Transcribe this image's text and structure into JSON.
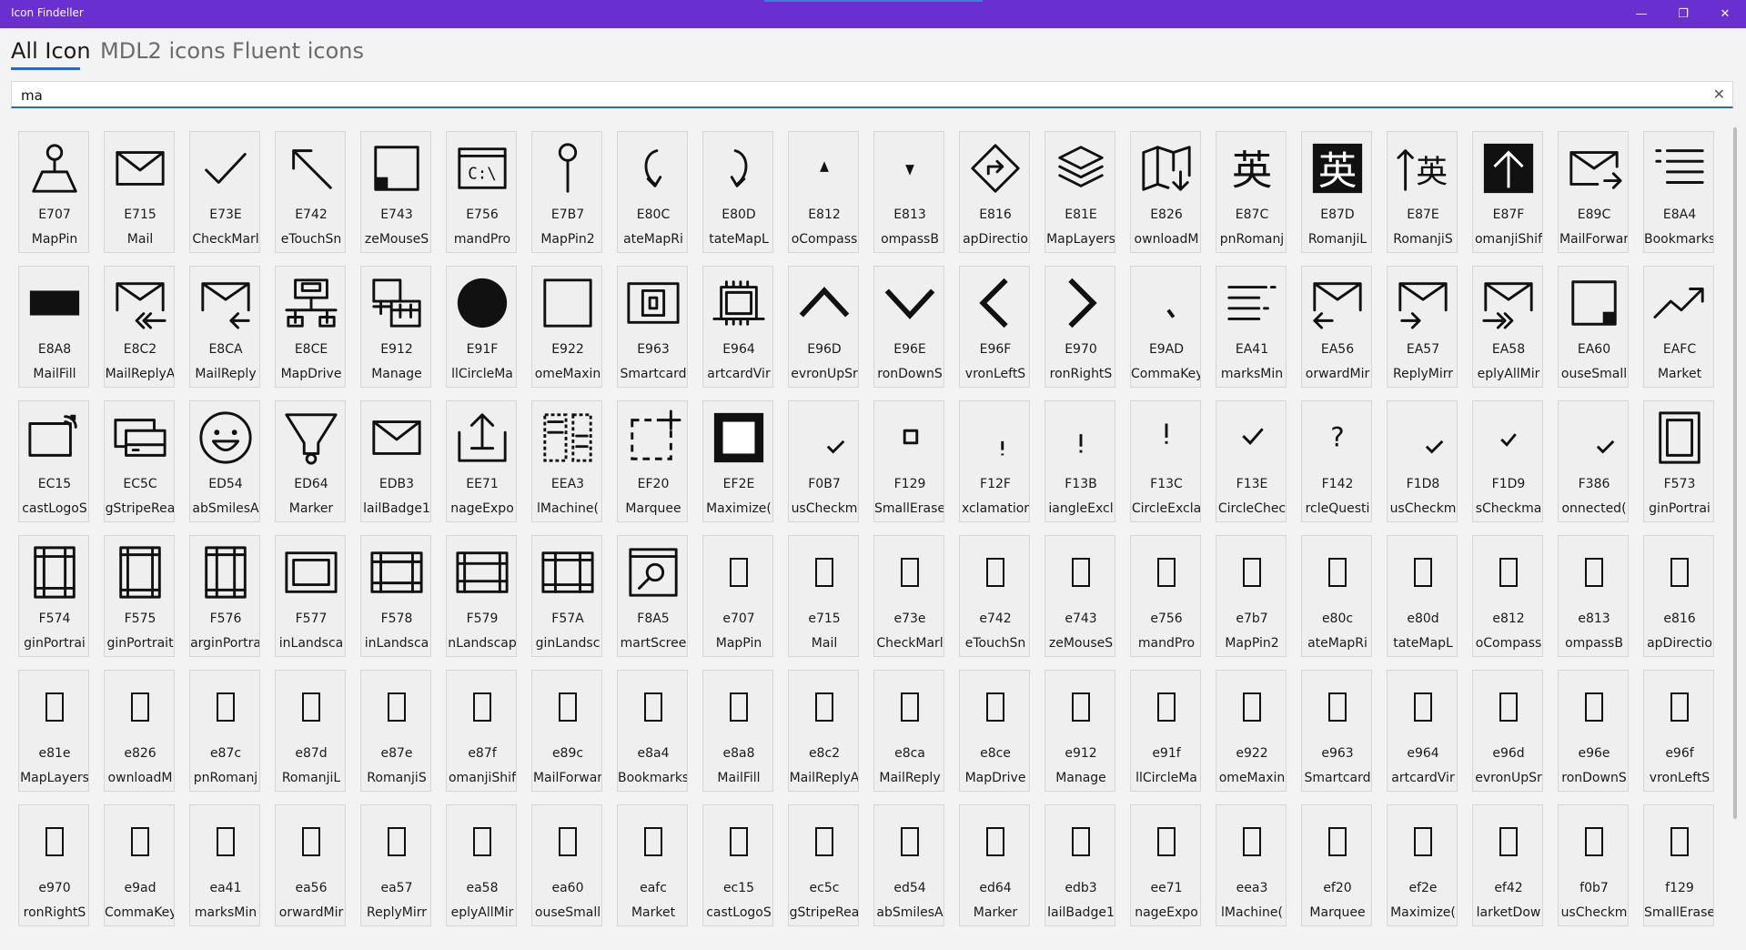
{
  "window": {
    "title": "Icon Findeller",
    "min_icon": "minimize-icon",
    "max_icon": "restore-icon",
    "close_icon": "close-icon"
  },
  "tabs": [
    {
      "label": "All Icon",
      "active": true
    },
    {
      "label": "MDL2 icons",
      "active": false
    },
    {
      "label": "Fluent icons",
      "active": false
    }
  ],
  "search": {
    "value": "ma",
    "clear_icon": "clear-icon"
  },
  "colors": {
    "titlebar": "#6a2fd1",
    "accent": "#2b67c6"
  },
  "icons": [
    {
      "code": "E707",
      "name": "MapPin",
      "glyph": "map-pin"
    },
    {
      "code": "E715",
      "name": "Mail",
      "glyph": "mail"
    },
    {
      "code": "E73E",
      "name": "CheckMarl",
      "glyph": "checkmark"
    },
    {
      "code": "E742",
      "name": "eTouchSn",
      "glyph": "arrow-upleft"
    },
    {
      "code": "E743",
      "name": "zeMouseS",
      "glyph": "square-corner"
    },
    {
      "code": "E756",
      "name": "mandPro",
      "glyph": "command-prompt"
    },
    {
      "code": "E7B7",
      "name": "MapPin2",
      "glyph": "pin2"
    },
    {
      "code": "E80C",
      "name": "ateMapRi",
      "glyph": "rotate-right"
    },
    {
      "code": "E80D",
      "name": "tateMapL",
      "glyph": "rotate-left"
    },
    {
      "code": "E812",
      "name": "oCompass",
      "glyph": "tri-up"
    },
    {
      "code": "E813",
      "name": "ompassB",
      "glyph": "tri-down"
    },
    {
      "code": "E816",
      "name": "apDirectio",
      "glyph": "directions"
    },
    {
      "code": "E81E",
      "name": "MapLayers",
      "glyph": "layers"
    },
    {
      "code": "E826",
      "name": "ownloadM",
      "glyph": "map-download"
    },
    {
      "code": "E87C",
      "name": "pnRomanj",
      "glyph": "kanji"
    },
    {
      "code": "E87D",
      "name": "RomanjiL",
      "glyph": "kanji-inv"
    },
    {
      "code": "E87E",
      "name": "RomanjiS",
      "glyph": "kanji-arrow"
    },
    {
      "code": "E87F",
      "name": "omanjiShif",
      "glyph": "shift-box"
    },
    {
      "code": "E89C",
      "name": "MailForwar",
      "glyph": "mail-forward"
    },
    {
      "code": "E8A4",
      "name": "Bookmarks",
      "glyph": "bookmarks"
    },
    {
      "code": "E8A8",
      "name": "MailFill",
      "glyph": "mail-fill"
    },
    {
      "code": "E8C2",
      "name": "MailReplyA",
      "glyph": "mail-replyall"
    },
    {
      "code": "E8CA",
      "name": "MailReply",
      "glyph": "mail-reply"
    },
    {
      "code": "E8CE",
      "name": "MapDrive",
      "glyph": "map-drive"
    },
    {
      "code": "E912",
      "name": "Manage",
      "glyph": "manage"
    },
    {
      "code": "E91F",
      "name": "llCircleMa",
      "glyph": "circle-fill"
    },
    {
      "code": "E922",
      "name": "omeMaxin",
      "glyph": "square"
    },
    {
      "code": "E963",
      "name": "Smartcard",
      "glyph": "smartcard"
    },
    {
      "code": "E964",
      "name": "artcardVir",
      "glyph": "chip"
    },
    {
      "code": "E96D",
      "name": "evronUpSr",
      "glyph": "chevron-up"
    },
    {
      "code": "E96E",
      "name": "ronDownS",
      "glyph": "chevron-down"
    },
    {
      "code": "E96F",
      "name": "vronLeftS",
      "glyph": "chevron-left"
    },
    {
      "code": "E970",
      "name": "ronRightS",
      "glyph": "chevron-right"
    },
    {
      "code": "E9AD",
      "name": "CommaKey",
      "glyph": "comma"
    },
    {
      "code": "EA41",
      "name": "marksMin",
      "glyph": "bookmarks-small"
    },
    {
      "code": "EA56",
      "name": "orwardMir",
      "glyph": "mail-forward-mirror"
    },
    {
      "code": "EA57",
      "name": "ReplyMirr",
      "glyph": "mail-reply-mirror"
    },
    {
      "code": "EA58",
      "name": "eplyAllMir",
      "glyph": "mail-replyall-mirror"
    },
    {
      "code": "EA60",
      "name": "ouseSmall",
      "glyph": "square-corner-br"
    },
    {
      "code": "EAFC",
      "name": "Market",
      "glyph": "trend"
    },
    {
      "code": "EC15",
      "name": "castLogoS",
      "glyph": "cast"
    },
    {
      "code": "EC5C",
      "name": "gStripeRea",
      "glyph": "card-stripe"
    },
    {
      "code": "ED54",
      "name": "abSmilesA",
      "glyph": "smile"
    },
    {
      "code": "ED64",
      "name": "Marker",
      "glyph": "marker"
    },
    {
      "code": "EDB3",
      "name": "lailBadge1",
      "glyph": "mail-badge"
    },
    {
      "code": "EE71",
      "name": "nageExpo",
      "glyph": "export"
    },
    {
      "code": "EEA3",
      "name": "lMachine(",
      "glyph": "machine"
    },
    {
      "code": "EF20",
      "name": "Marquee",
      "glyph": "marquee"
    },
    {
      "code": "EF2E",
      "name": "Maximize(",
      "glyph": "maximize"
    },
    {
      "code": "F0B7",
      "name": "usCheckm",
      "glyph": "small-check"
    },
    {
      "code": "F129",
      "name": "SmallErase",
      "glyph": "small-square"
    },
    {
      "code": "F12F",
      "name": "xclamatior",
      "glyph": "small-excl"
    },
    {
      "code": "F13B",
      "name": "iangleExcl",
      "glyph": "excl"
    },
    {
      "code": "F13C",
      "name": "CircleExcla",
      "glyph": "excl-high"
    },
    {
      "code": "F13E",
      "name": "CircleChec",
      "glyph": "check-mid"
    },
    {
      "code": "F142",
      "name": "rcleQuesti",
      "glyph": "question"
    },
    {
      "code": "F1D8",
      "name": "usCheckm",
      "glyph": "small-check"
    },
    {
      "code": "F1D9",
      "name": "sCheckma",
      "glyph": "check-mid-small"
    },
    {
      "code": "F386",
      "name": "onnected(",
      "glyph": "small-check"
    },
    {
      "code": "F573",
      "name": "ginPortrai",
      "glyph": "portrait-margin"
    },
    {
      "code": "F574",
      "name": "ginPortrai",
      "glyph": "portrait-grid"
    },
    {
      "code": "F575",
      "name": "ginPortrait",
      "glyph": "portrait-grid2"
    },
    {
      "code": "F576",
      "name": "arginPortra",
      "glyph": "portrait-grid3"
    },
    {
      "code": "F577",
      "name": "inLandsca",
      "glyph": "landscape"
    },
    {
      "code": "F578",
      "name": "inLandsca",
      "glyph": "landscape2"
    },
    {
      "code": "F579",
      "name": "nLandscap",
      "glyph": "landscape3"
    },
    {
      "code": "F57A",
      "name": "ginLandsc",
      "glyph": "landscape4"
    },
    {
      "code": "F8A5",
      "name": "martScree",
      "glyph": "smart-screen"
    },
    {
      "code": "e707",
      "name": "MapPin",
      "glyph": "box"
    },
    {
      "code": "e715",
      "name": "Mail",
      "glyph": "box"
    },
    {
      "code": "e73e",
      "name": "CheckMarl",
      "glyph": "box"
    },
    {
      "code": "e742",
      "name": "eTouchSn",
      "glyph": "box"
    },
    {
      "code": "e743",
      "name": "zeMouseS",
      "glyph": "box"
    },
    {
      "code": "e756",
      "name": "mandPro",
      "glyph": "box"
    },
    {
      "code": "e7b7",
      "name": "MapPin2",
      "glyph": "box"
    },
    {
      "code": "e80c",
      "name": "ateMapRi",
      "glyph": "box"
    },
    {
      "code": "e80d",
      "name": "tateMapL",
      "glyph": "box"
    },
    {
      "code": "e812",
      "name": "oCompass",
      "glyph": "box"
    },
    {
      "code": "e813",
      "name": "ompassB",
      "glyph": "box"
    },
    {
      "code": "e816",
      "name": "apDirectio",
      "glyph": "box"
    },
    {
      "code": "e81e",
      "name": "MapLayers",
      "glyph": "box"
    },
    {
      "code": "e826",
      "name": "ownloadM",
      "glyph": "box"
    },
    {
      "code": "e87c",
      "name": "pnRomanj",
      "glyph": "box"
    },
    {
      "code": "e87d",
      "name": "RomanjiL",
      "glyph": "box"
    },
    {
      "code": "e87e",
      "name": "RomanjiS",
      "glyph": "box"
    },
    {
      "code": "e87f",
      "name": "omanjiShif",
      "glyph": "box"
    },
    {
      "code": "e89c",
      "name": "MailForwar",
      "glyph": "box"
    },
    {
      "code": "e8a4",
      "name": "Bookmarks",
      "glyph": "box"
    },
    {
      "code": "e8a8",
      "name": "MailFill",
      "glyph": "box"
    },
    {
      "code": "e8c2",
      "name": "MailReplyA",
      "glyph": "box"
    },
    {
      "code": "e8ca",
      "name": "MailReply",
      "glyph": "box"
    },
    {
      "code": "e8ce",
      "name": "MapDrive",
      "glyph": "box"
    },
    {
      "code": "e912",
      "name": "Manage",
      "glyph": "box"
    },
    {
      "code": "e91f",
      "name": "llCircleMa",
      "glyph": "box"
    },
    {
      "code": "e922",
      "name": "omeMaxin",
      "glyph": "box"
    },
    {
      "code": "e963",
      "name": "Smartcard",
      "glyph": "box"
    },
    {
      "code": "e964",
      "name": "artcardVir",
      "glyph": "box"
    },
    {
      "code": "e96d",
      "name": "evronUpSr",
      "glyph": "box"
    },
    {
      "code": "e96e",
      "name": "ronDownS",
      "glyph": "box"
    },
    {
      "code": "e96f",
      "name": "vronLeftS",
      "glyph": "box"
    },
    {
      "code": "e970",
      "name": "ronRightS",
      "glyph": "box"
    },
    {
      "code": "e9ad",
      "name": "CommaKey",
      "glyph": "box"
    },
    {
      "code": "ea41",
      "name": "marksMin",
      "glyph": "box"
    },
    {
      "code": "ea56",
      "name": "orwardMir",
      "glyph": "box"
    },
    {
      "code": "ea57",
      "name": "ReplyMirr",
      "glyph": "box"
    },
    {
      "code": "ea58",
      "name": "eplyAllMir",
      "glyph": "box"
    },
    {
      "code": "ea60",
      "name": "ouseSmall",
      "glyph": "box"
    },
    {
      "code": "eafc",
      "name": "Market",
      "glyph": "box"
    },
    {
      "code": "ec15",
      "name": "castLogoS",
      "glyph": "box"
    },
    {
      "code": "ec5c",
      "name": "gStripeRea",
      "glyph": "box"
    },
    {
      "code": "ed54",
      "name": "abSmilesA",
      "glyph": "box"
    },
    {
      "code": "ed64",
      "name": "Marker",
      "glyph": "box"
    },
    {
      "code": "edb3",
      "name": "lailBadge1",
      "glyph": "box"
    },
    {
      "code": "ee71",
      "name": "nageExpo",
      "glyph": "box"
    },
    {
      "code": "eea3",
      "name": "lMachine(",
      "glyph": "box"
    },
    {
      "code": "ef20",
      "name": "Marquee",
      "glyph": "box"
    },
    {
      "code": "ef2e",
      "name": "Maximize(",
      "glyph": "box"
    },
    {
      "code": "ef42",
      "name": "larketDow",
      "glyph": "box"
    },
    {
      "code": "f0b7",
      "name": "usCheckm",
      "glyph": "box"
    },
    {
      "code": "f129",
      "name": "SmallErase",
      "glyph": "box"
    }
  ]
}
